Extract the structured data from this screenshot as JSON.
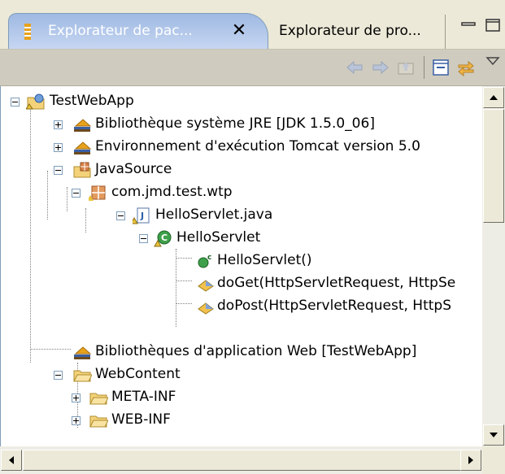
{
  "tabs": [
    {
      "label": "Explorateur de pac...",
      "active": true,
      "icon": "package-explorer-icon"
    },
    {
      "label": "Explorateur de pro...",
      "active": false
    }
  ],
  "window_controls": [
    "minimize-icon",
    "maximize-icon"
  ],
  "toolbar": [
    "back-arrow-icon",
    "forward-arrow-icon",
    "up-folder-icon",
    "collapse-all-icon",
    "link-with-editor-icon",
    "view-menu-icon"
  ],
  "tree": {
    "root": "TestWebApp",
    "jre_library": "Bibliothèque système JRE [JDK 1.5.0_06]",
    "tomcat_runtime": "Environnement d'exécution Tomcat version 5.0",
    "source_folder": "JavaSource",
    "package": "com.jmd.test.wtp",
    "java_file": "HelloServlet.java",
    "class_name": "HelloServlet",
    "constructor": "HelloServlet()",
    "method_doget": "doGet(HttpServletRequest, HttpSe",
    "method_dopost": "doPost(HttpServletRequest, HttpS",
    "web_app_libraries": "Bibliothèques d'application Web [TestWebApp]",
    "web_content": "WebContent",
    "meta_inf": "META-INF",
    "web_inf": "WEB-INF"
  },
  "colors": {
    "active_tab": "#a6bee6",
    "toolbar_bg": "#cfcbbf",
    "library_icon": "#e8a21c",
    "folder_icon": "#f3d27a"
  }
}
